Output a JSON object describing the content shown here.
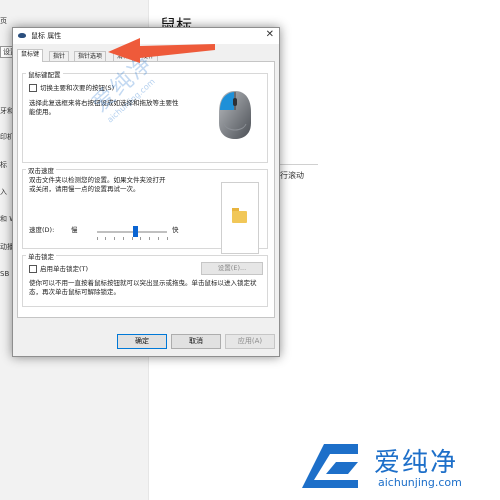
{
  "background": {
    "title": "鼠标",
    "nav_items": [
      "页",
      "设置",
      "牙和",
      "印机",
      "标",
      "入",
      "和 W",
      "动播",
      "SB"
    ],
    "scroll_text": "进行滚动"
  },
  "dialog": {
    "title": "鼠标 属性",
    "close": "✕",
    "tabs": [
      "鼠标键",
      "指针",
      "指针选项",
      "滑轮",
      "硬件"
    ],
    "button_config": {
      "legend": "鼠标键配置",
      "checkbox_label": "切换主要和次要的按钮(S)",
      "desc": "选择此复选框来将右按钮设成如选择和拖放等主要性能使用。"
    },
    "double_click": {
      "legend": "双击速度",
      "desc": "双击文件夹以检测您的设置。如果文件夹没打开或关闭，请用慢一点的设置再试一次。",
      "speed_label": "速度(D):",
      "slow": "慢",
      "fast": "快",
      "speed_level": 0.55
    },
    "click_lock": {
      "legend": "单击锁定",
      "checkbox_label": "启用单击锁定(T)",
      "settings_button": "设置(E)...",
      "desc": "使你可以不用一直按着鼠标按钮就可以突出显示或拖曳。单击鼠标以进入锁定状态，再次单击鼠标可解除锁定。"
    },
    "buttons": {
      "ok": "确定",
      "cancel": "取消",
      "apply": "应用(A)"
    }
  },
  "watermark": {
    "center_cn": "爱纯净",
    "center_url": "aichunjing.com",
    "corner_cn": "爱纯净",
    "corner_url": "aichunjing.com"
  },
  "colors": {
    "accent": "#0078d7",
    "arrow": "#ee5a3a",
    "watermark": "#1d6fc9"
  }
}
